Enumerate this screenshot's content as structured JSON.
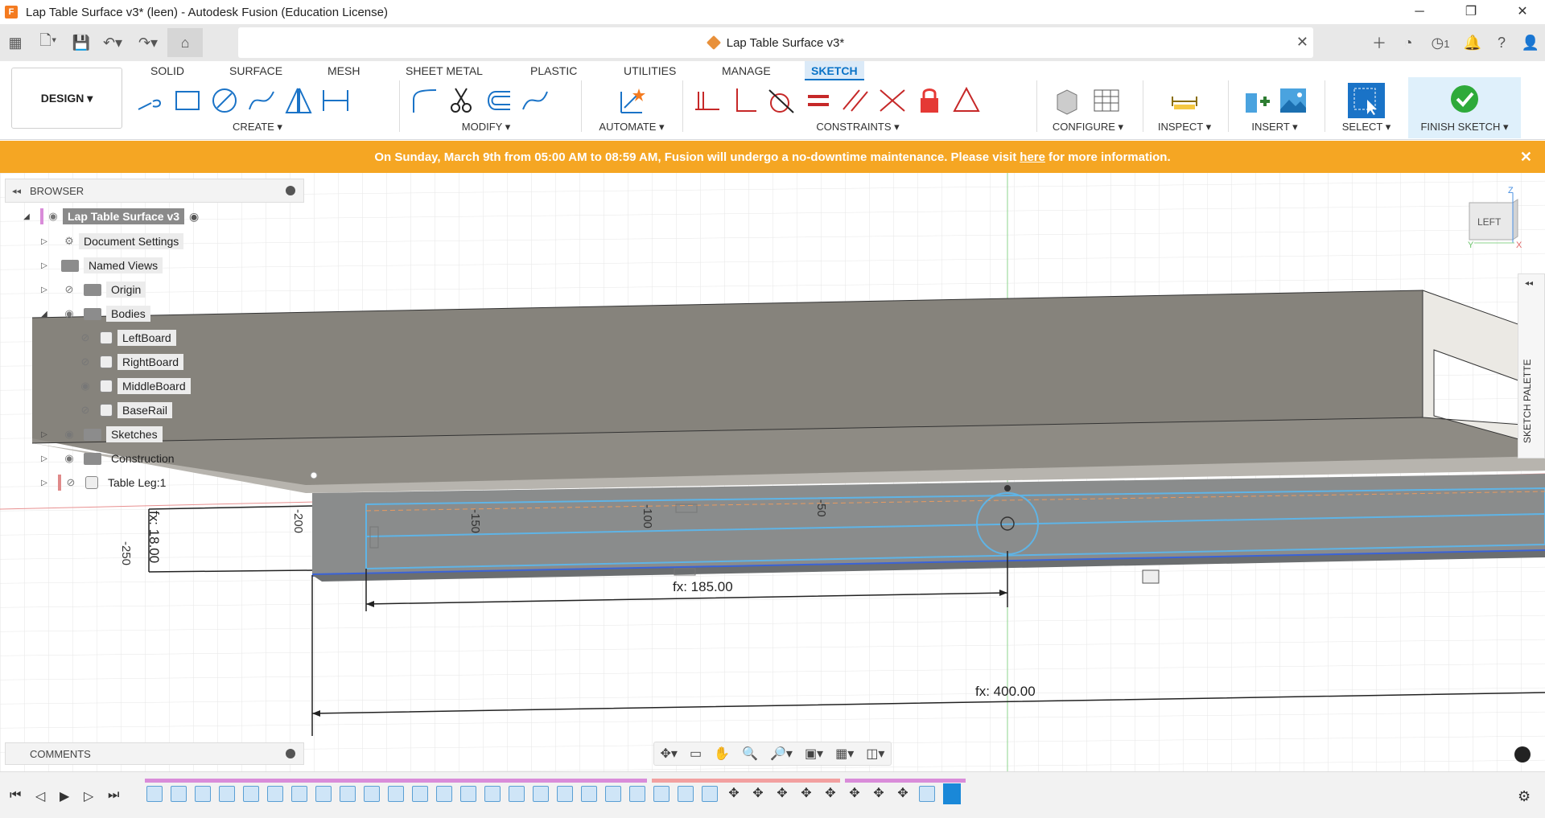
{
  "window": {
    "title": "Lap Table Surface v3* (leen) - Autodesk Fusion (Education License)",
    "minimize": "─",
    "restore": "❐",
    "close": "✕"
  },
  "document_tab": {
    "title": "Lap Table Surface v3*",
    "close": "✕"
  },
  "quick_access": {
    "job_count": "1"
  },
  "ribbon": {
    "workspace": "DESIGN ▾",
    "tabs": [
      "SOLID",
      "SURFACE",
      "MESH",
      "SHEET METAL",
      "PLASTIC",
      "UTILITIES",
      "MANAGE",
      "SKETCH"
    ],
    "active_tab": "SKETCH",
    "groups": {
      "create": "CREATE ▾",
      "modify": "MODIFY ▾",
      "automate": "AUTOMATE ▾",
      "constraints": "CONSTRAINTS ▾",
      "configure": "CONFIGURE ▾",
      "inspect": "INSPECT ▾",
      "insert": "INSERT ▾",
      "select": "SELECT ▾",
      "finish": "FINISH SKETCH ▾"
    }
  },
  "banner": {
    "text_before": "On Sunday, March 9th from 05:00 AM to 08:59 AM, Fusion will undergo a no-downtime maintenance. Please visit",
    "link": "here",
    "text_after": "for more information.",
    "close": "✕"
  },
  "browser": {
    "title": "BROWSER",
    "root": "Lap Table Surface v3",
    "items": [
      {
        "label": "Document Settings"
      },
      {
        "label": "Named Views"
      },
      {
        "label": "Origin"
      },
      {
        "label": "Bodies"
      },
      {
        "label": "LeftBoard"
      },
      {
        "label": "RightBoard"
      },
      {
        "label": "MiddleBoard"
      },
      {
        "label": "BaseRail"
      },
      {
        "label": "Sketches"
      },
      {
        "label": "Construction"
      },
      {
        "label": "Table Leg:1"
      }
    ]
  },
  "comments": {
    "title": "COMMENTS"
  },
  "sketch_palette": {
    "label": "SKETCH PALETTE"
  },
  "viewcube": {
    "face": "LEFT",
    "axis_z": "Z",
    "axis_y": "Y",
    "axis_x": "X"
  },
  "canvas": {
    "dimensions": [
      "fx: 18.00",
      "fx: 185.00",
      "fx: 400.00"
    ],
    "ruler_labels": [
      "-250",
      "-200",
      "-150",
      "-100",
      "-50"
    ]
  }
}
